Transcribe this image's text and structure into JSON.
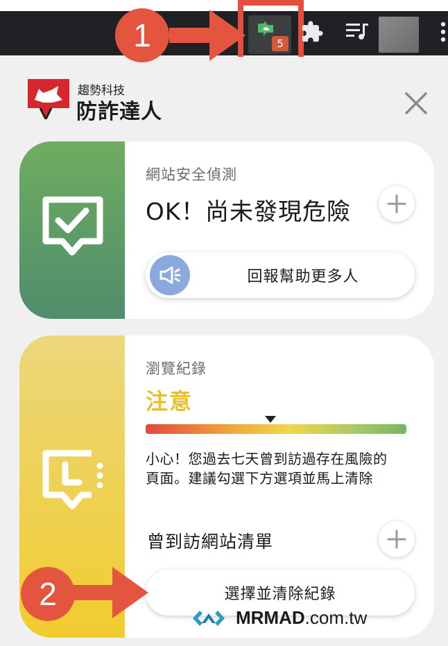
{
  "toolbar": {
    "extension_badge_count": "5",
    "icons": [
      "fraud-prevention-extension-icon",
      "puzzle-icon",
      "playlist-icon",
      "avatar",
      "more-menu-icon"
    ]
  },
  "annotations": {
    "step1": "1",
    "step2": "2",
    "accent_color": "#e4553f"
  },
  "popup": {
    "brand_sub": "趨勢科技",
    "brand_title": "防詐達人",
    "close_icon": "close-icon"
  },
  "site_card": {
    "label": "網站安全偵測",
    "status": "OK！尚未發現危險",
    "report_button": "回報幫助更多人",
    "color": "#5e9e66"
  },
  "history_card": {
    "label": "瀏覽紀錄",
    "status": "注意",
    "risk_level": 0.48,
    "warning_text": "小心！您過去七天曾到訪過存在風險的頁面。建議勾選下方選項並馬上清除",
    "list_title": "曾到訪網站清單",
    "clear_button": "選擇並清除紀錄",
    "color": "#f1cc2e",
    "status_color": "#e6c12c"
  },
  "watermark": {
    "brand_bold": "MRMAD",
    "brand_rest": ".com.tw"
  }
}
